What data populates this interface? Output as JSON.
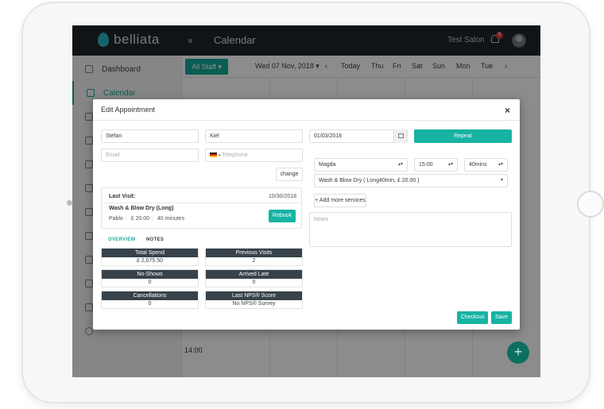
{
  "app": {
    "logo_text": "belliata",
    "page_title": "Calendar",
    "salon_name": "Test Salon",
    "notification_count": "8"
  },
  "sidebar": {
    "items": [
      {
        "label": "Dashboard",
        "active": false
      },
      {
        "label": "Calendar",
        "active": true
      }
    ]
  },
  "calendar_toolbar": {
    "staff_filter": "All Staff ▾",
    "date": "Wed 07 Nov, 2018 ▾",
    "prev": "‹",
    "today": "Today",
    "days": [
      "Thu",
      "Fri",
      "Sat",
      "Sun",
      "Mon",
      "Tue"
    ],
    "next": "›",
    "time_label": "14:00"
  },
  "modal": {
    "title": "Edit Appointment",
    "close": "×",
    "first_name": "Stefan",
    "last_name": "Kiel",
    "email_placeholder": "Email",
    "telephone_placeholder": "Telephone",
    "change_label": "change",
    "date": "01/03/2018",
    "repeat_label": "Repeat",
    "staff": "Magda",
    "time": "15:00",
    "duration": "40mins",
    "service": "Wash & Blow Dry ( Long40min, £ 20.00 )",
    "add_services_label": "+ Add more services",
    "notes_placeholder": "Notes",
    "last_visit": {
      "title": "Last Visit:",
      "date": "10/30/2018",
      "service": "Wash & Blow Dry (Long)",
      "staff": "Pablo",
      "price": "£ 20.00",
      "duration": "40 minutes",
      "rebook_label": "Rebook"
    },
    "tabs": [
      {
        "label": "OVERVIEW",
        "active": true
      },
      {
        "label": "NOTES",
        "active": false
      }
    ],
    "stats": [
      {
        "label": "Total Spend",
        "value": "£ 2,075.50"
      },
      {
        "label": "Previous Visits",
        "value": "2"
      },
      {
        "label": "No-Shows",
        "value": "0"
      },
      {
        "label": "Arrived Late",
        "value": "0"
      },
      {
        "label": "Cancellations",
        "value": "0"
      },
      {
        "label": "Last NPS® Score",
        "value": "No NPS® Survey"
      }
    ],
    "checkout_label": "Checkout",
    "save_label": "Save"
  },
  "colors": {
    "accent": "#17b3a3",
    "topbar": "#1f2529",
    "stat_header": "#37424a"
  }
}
